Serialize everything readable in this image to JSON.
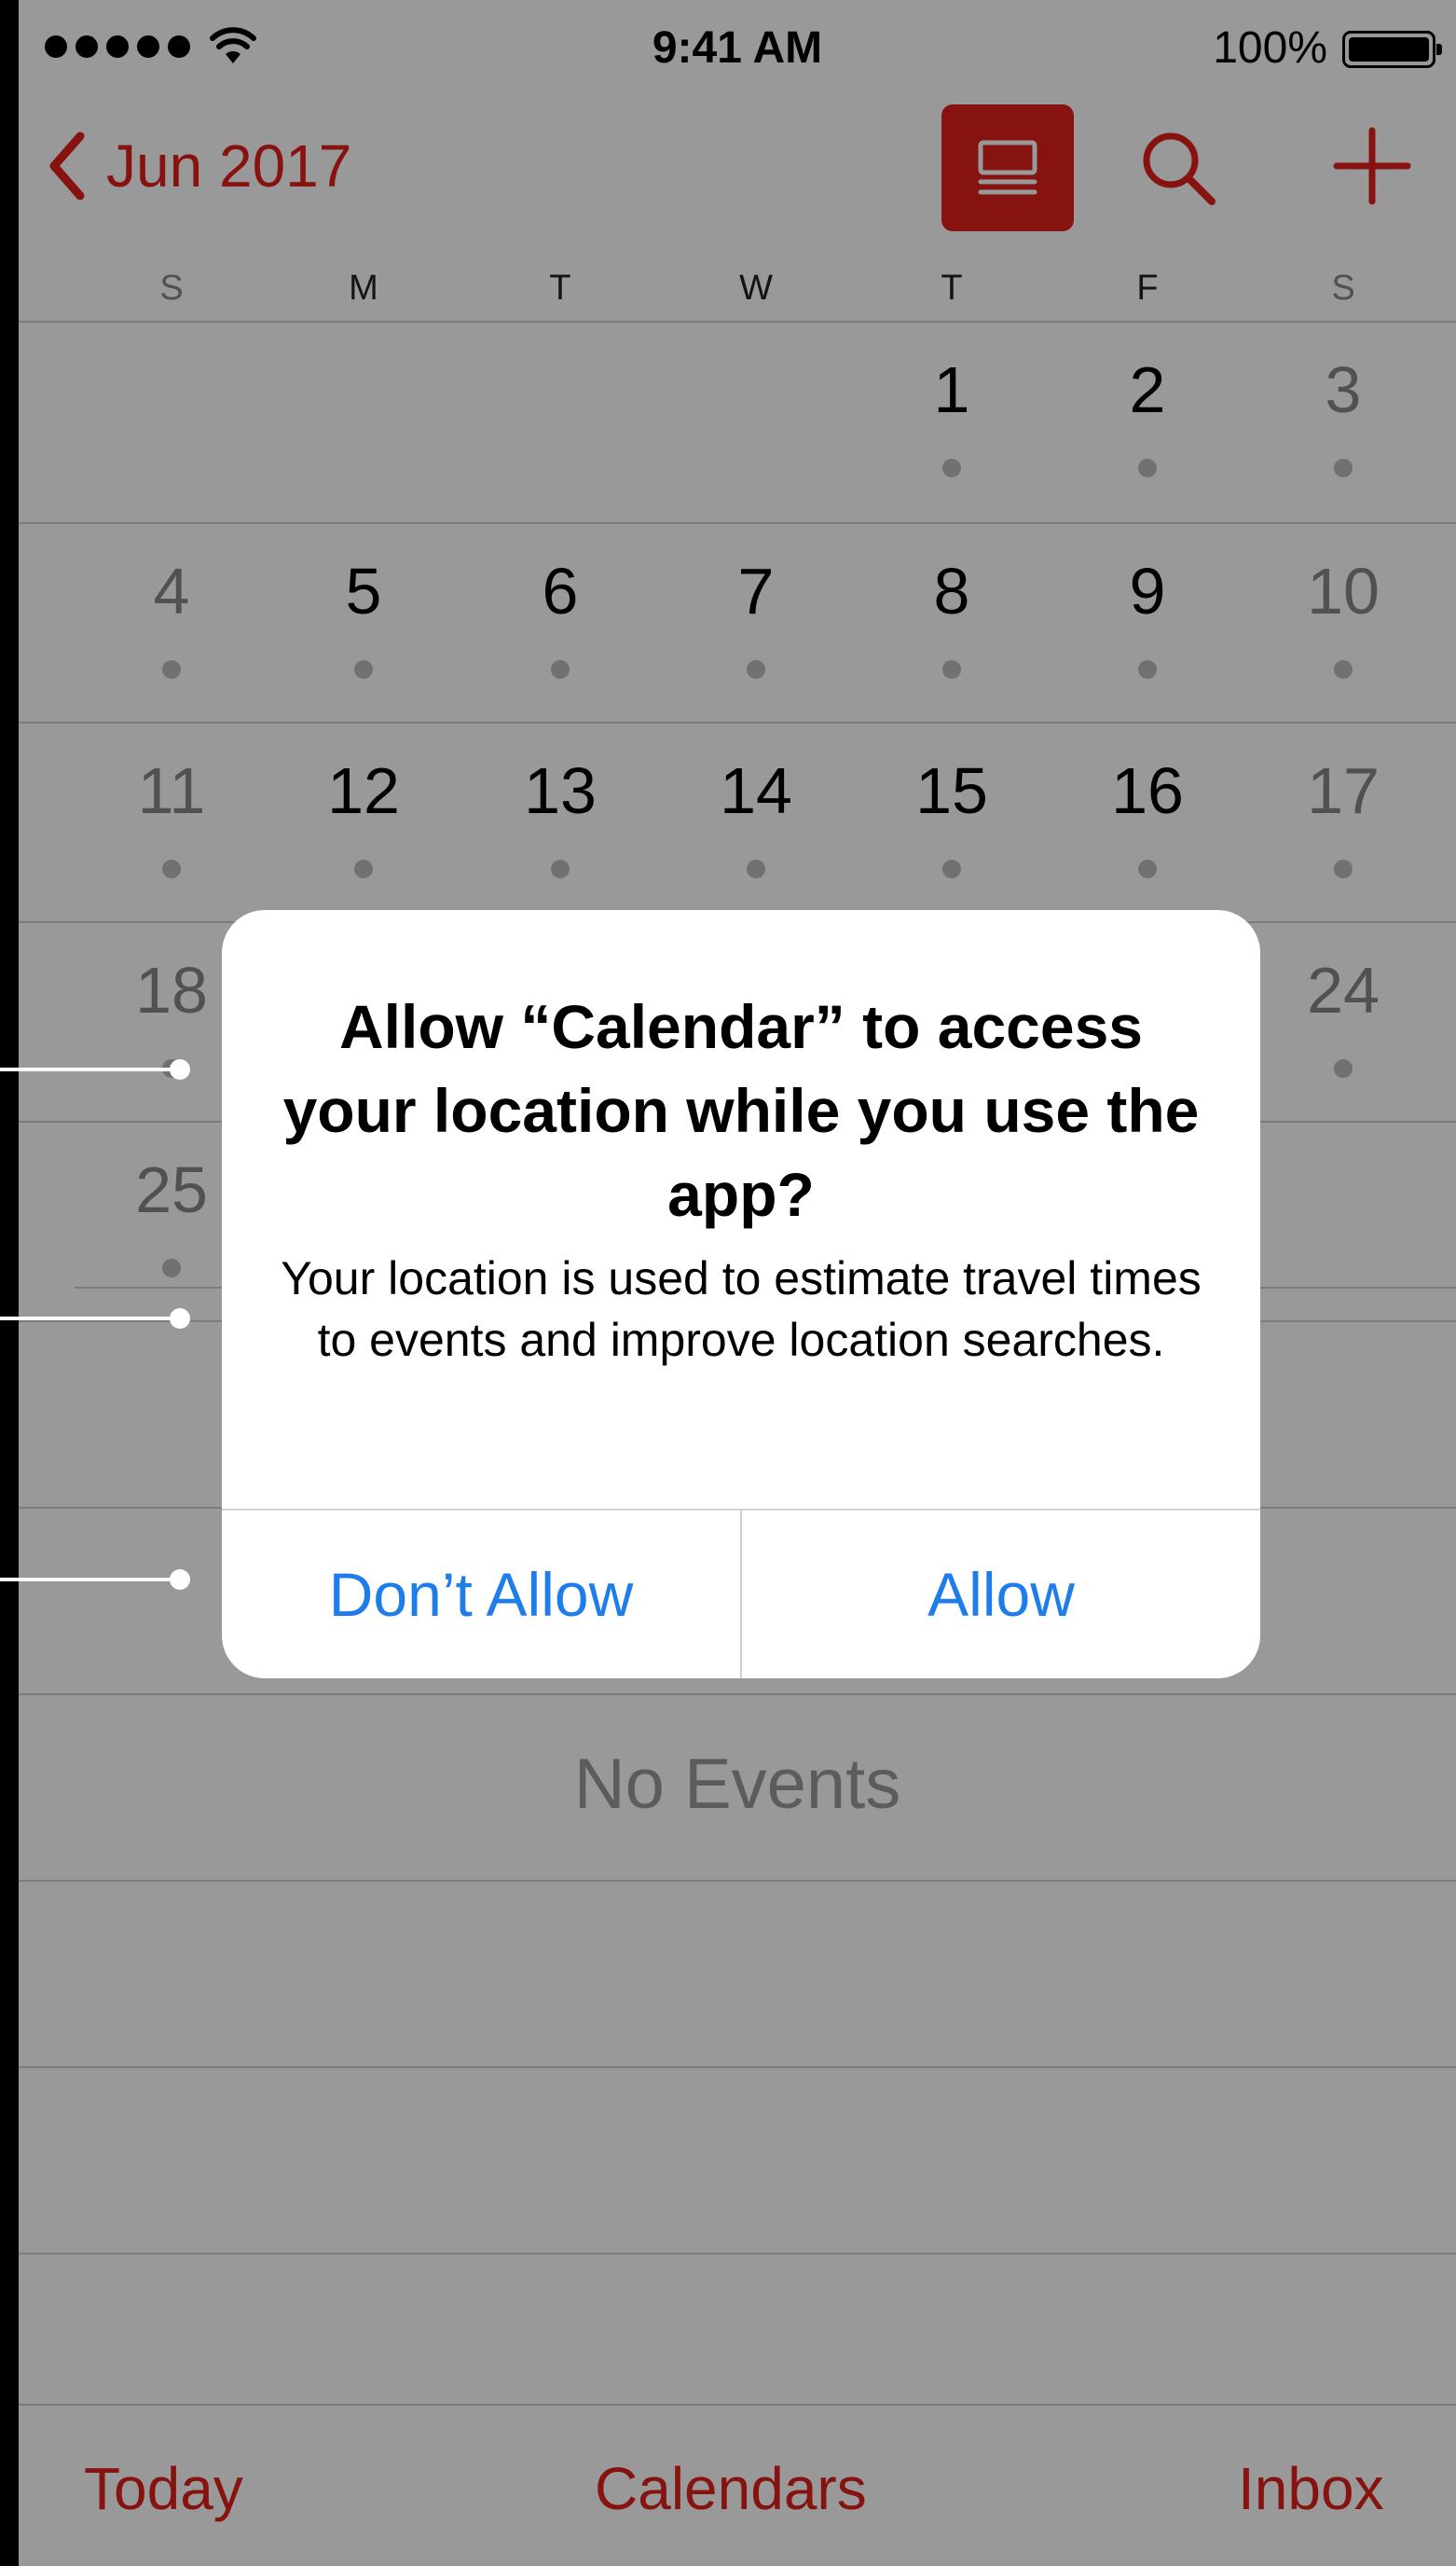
{
  "status_bar": {
    "time": "9:41 AM",
    "battery_percent": "100%"
  },
  "nav": {
    "month_title": "Jun 2017",
    "back_icon": "chevron-left-icon",
    "list_view_icon": "list-view-icon",
    "search_icon": "search-icon",
    "add_icon": "plus-icon"
  },
  "weekdays": [
    "S",
    "M",
    "T",
    "W",
    "T",
    "F",
    "S"
  ],
  "calendar": {
    "weeks": [
      [
        "",
        "",
        "",
        "",
        "1",
        "2",
        "3"
      ],
      [
        "4",
        "5",
        "6",
        "7",
        "8",
        "9",
        "10"
      ],
      [
        "11",
        "12",
        "13",
        "14",
        "15",
        "16",
        "17"
      ],
      [
        "18",
        "",
        "",
        "",
        "",
        "",
        "24"
      ],
      [
        "25",
        "",
        "",
        "",
        "",
        "",
        ""
      ]
    ]
  },
  "events": {
    "empty_text": "No Events"
  },
  "tab_bar": {
    "today": "Today",
    "calendars": "Calendars",
    "inbox": "Inbox"
  },
  "alert": {
    "title": "Allow “Calendar” to access your location while you use the app?",
    "message": "Your location is used to estimate travel times to events and improve location searches.",
    "dont_allow_label": "Don’t Allow",
    "allow_label": "Allow"
  },
  "colors": {
    "accent_red": "#e0211c",
    "alert_button_blue": "#1f7de9",
    "dim_overlay": "rgba(0,0,0,0.40)"
  }
}
